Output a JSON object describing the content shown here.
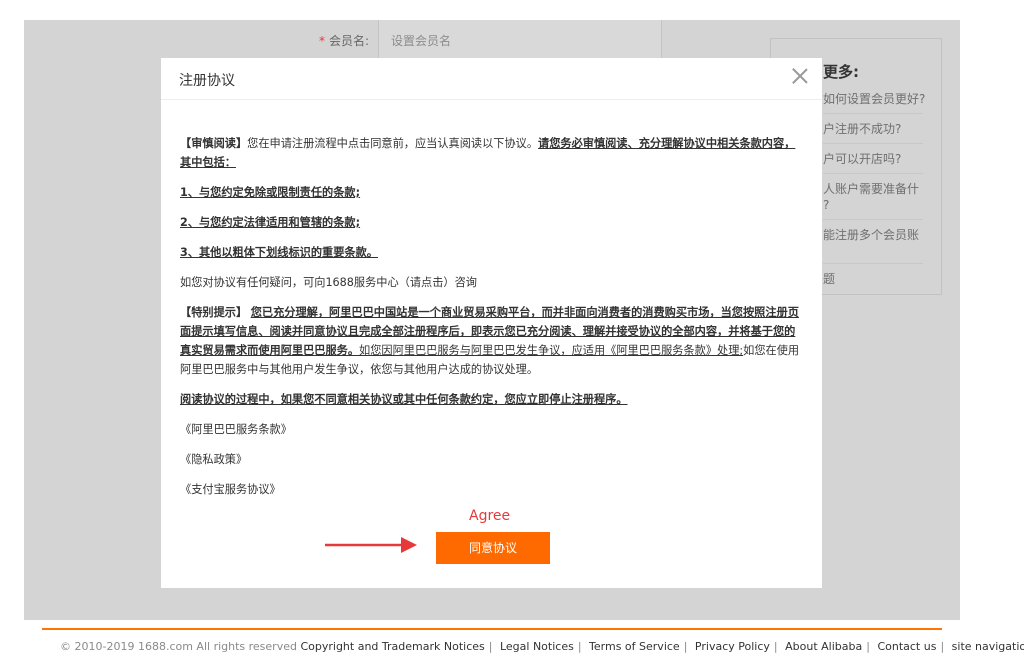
{
  "background": {
    "form_label": "会员名:",
    "required_mark": "*",
    "input_placeholder": "设置会员名",
    "sidebar_title": "更多:",
    "sidebar_items": [
      "如何设置会员更好?",
      "户注册不成功?",
      "户可以开店吗?",
      "人账户需要准备什\n?",
      "能注册多个会员账",
      "题"
    ]
  },
  "modal": {
    "title": "注册协议",
    "p1_bracket": "【审慎阅读】",
    "p1_text": "您在申请注册流程中点击同意前，应当认真阅读以下协议。",
    "p1_bold": "请您务必审慎阅读、充分理解协议中相关条款内容，其中包括：",
    "item1": "1、与您约定免除或限制责任的条款;",
    "item2": "2、与您约定法律适用和管辖的条款;",
    "item3": "3、其他以粗体下划线标识的重要条款。",
    "contact": "如您对协议有任何疑问，可向1688服务中心（请点击）咨询",
    "p2_bracket": "【特别提示】",
    "p2_bold": "您已充分理解，阿里巴巴中国站是一个商业贸易采购平台，而并非面向消费者的消费购买市场，当您按照注册页面提示填写信息、阅读并同意协议且完成全部注册程序后，即表示您已充分阅读、理解并接受协议的全部内容，并将基于您的真实贸易需求而使用阿里巴巴服务。",
    "p2_text_u": "如您因阿里巴巴服务与阿里巴巴发生争议，应适用《阿里巴巴服务条款》处理;",
    "p2_text": "如您在使用阿里巴巴服务中与其他用户发生争议，依您与其他用户达成的协议处理。",
    "p3": "阅读协议的过程中，如果您不同意相关协议或其中任何条款约定，您应立即停止注册程序。",
    "link1": "《阿里巴巴服务条款》",
    "link2": "《隐私政策》",
    "link3": "《支付宝服务协议》",
    "agree_note": "Agree",
    "agree_button": "同意协议"
  },
  "footer": {
    "copyright": "© 2010-2019 1688.com All rights reserved",
    "links": [
      "Copyright and Trademark Notices",
      "Legal Notices",
      "Terms of Service",
      "Privacy Policy",
      "About Alibaba",
      "Contact us",
      "site navigation"
    ]
  },
  "colors": {
    "accent": "#ff6a00",
    "annotation": "#e63a3a",
    "footer_line": "#ff7300"
  }
}
